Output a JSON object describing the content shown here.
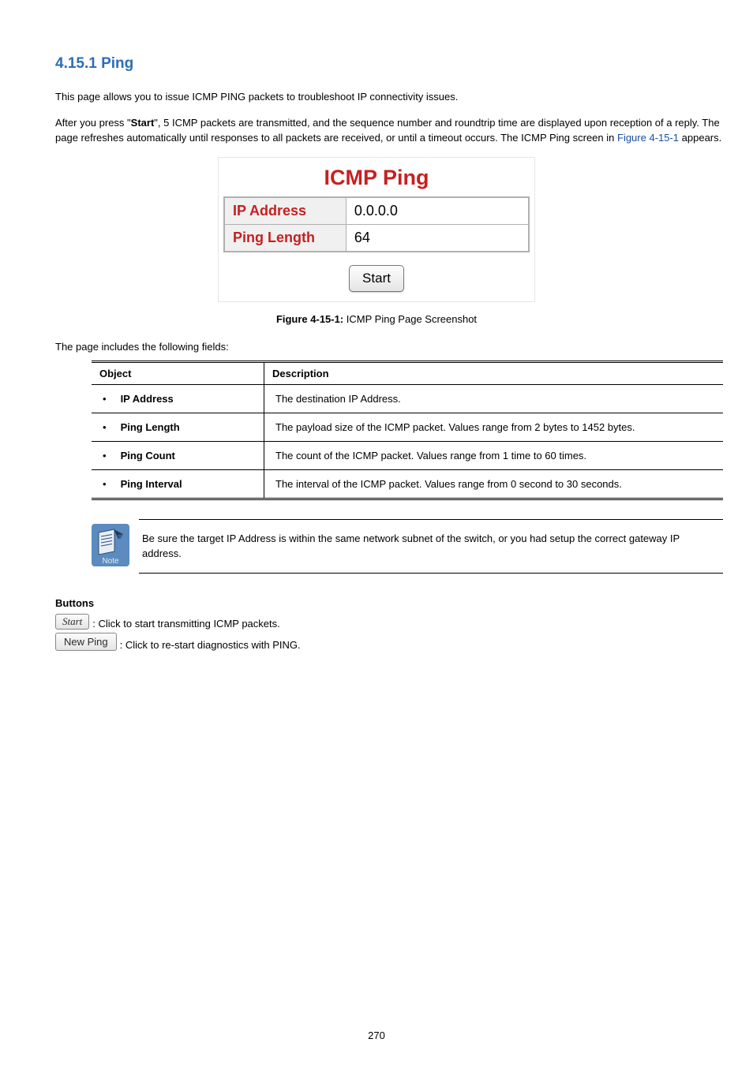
{
  "section_title": "4.15.1 Ping",
  "paragraphs": {
    "p1": "This page allows you to issue ICMP PING packets to troubleshoot IP connectivity issues.",
    "p2_a": "After you press \"",
    "p2_bold": "Start",
    "p2_b": "\", 5 ICMP packets are transmitted, and the sequence number and roundtrip time are displayed upon reception of a reply. The page refreshes automatically until responses to all packets are received, or until a timeout occurs. The ICMP Ping screen in ",
    "p2_link": "Figure 4-15-1",
    "p2_c": " appears."
  },
  "screenshot": {
    "title": "ICMP Ping",
    "rows": [
      {
        "label": "IP Address",
        "value": "0.0.0.0"
      },
      {
        "label": "Ping Length",
        "value": "64"
      }
    ],
    "start_btn": "Start"
  },
  "figure_caption": {
    "bold": "Figure 4-15-1:",
    "rest": " ICMP Ping Page Screenshot"
  },
  "fields_intro": "The page includes the following fields:",
  "fields_table": {
    "head_object": "Object",
    "head_desc": "Description",
    "rows": [
      {
        "obj": "IP Address",
        "desc": "The destination IP Address."
      },
      {
        "obj": "Ping Length",
        "desc": "The payload size of the ICMP packet. Values range from 2 bytes to 1452 bytes."
      },
      {
        "obj": "Ping Count",
        "desc": "The count of the ICMP packet. Values range from 1 time to 60 times."
      },
      {
        "obj": "Ping Interval",
        "desc": "The interval of the ICMP packet. Values range from 0 second to 30 seconds."
      }
    ]
  },
  "note": {
    "label": "Note",
    "text": "Be sure the target IP Address is within the same network subnet of the switch, or you had setup the correct gateway IP address."
  },
  "buttons_section": {
    "heading": "Buttons",
    "start_label": "Start",
    "start_desc": ": Click to start transmitting ICMP packets.",
    "newping_label": "New Ping",
    "newping_desc": ": Click to re-start diagnostics with PING."
  },
  "page_number": "270"
}
